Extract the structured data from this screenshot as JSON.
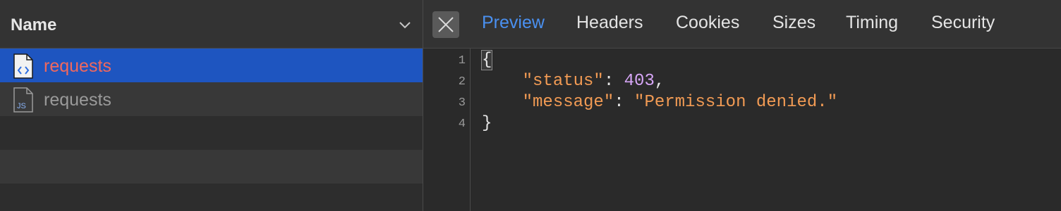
{
  "file_list": {
    "column_header": "Name",
    "rows": [
      {
        "label": "requests",
        "icon": "html-document-icon",
        "selected": true
      },
      {
        "label": "requests",
        "icon": "js-document-icon",
        "selected": false
      }
    ]
  },
  "preview": {
    "tabs": [
      {
        "label": "Preview",
        "active": true
      },
      {
        "label": "Headers",
        "active": false
      },
      {
        "label": "Cookies",
        "active": false
      },
      {
        "label": "Sizes",
        "active": false
      },
      {
        "label": "Timing",
        "active": false
      },
      {
        "label": "Security",
        "active": false
      }
    ],
    "line_numbers": [
      "1",
      "2",
      "3",
      "4"
    ],
    "code": {
      "open_brace": "{",
      "key_status": "\"status\"",
      "colon": ":",
      "value_status": "403",
      "comma": ",",
      "key_message": "\"message\"",
      "value_message": "\"Permission denied.\"",
      "close_brace": "}"
    }
  },
  "colors": {
    "selected_row": "#1e55c0",
    "active_tab": "#4a90f0",
    "string": "#f29b54",
    "number": "#d7a6f7"
  }
}
